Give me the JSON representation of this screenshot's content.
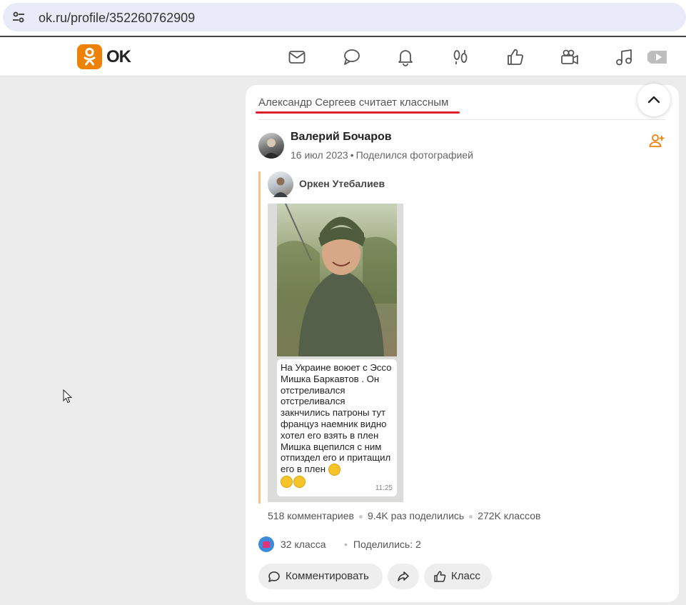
{
  "browser": {
    "url": "ok.ru/profile/352260762909"
  },
  "header": {
    "logo_text": "OK",
    "nav_icons": [
      "mail-icon",
      "chat-icon",
      "bell-icon",
      "footprints-icon",
      "like-icon",
      "video-camera-icon",
      "music-icon",
      "play-icon"
    ]
  },
  "feed": {
    "liked_by_text": "Александр Сергеев считает классным",
    "post": {
      "author": "Валерий Бочаров",
      "date": "16 июл 2023",
      "action": "Поделился фотографией",
      "reshared_from": "Оркен Утебалиев",
      "photo": {
        "caption": "На Украине воюет с Эссо Мишка Баркавтов . Он отстреливался отстреливался закнчились патроны тут француз наемник видно хотел его взять в плен Мишка вцепился с ним отпиздел его и притащил его в плен",
        "time": "11:25"
      },
      "stats": {
        "comments": "518 комментариев",
        "shares": "9.4K раз поделились",
        "likes": "272K классов"
      },
      "reactions": {
        "count_label": "32 класса",
        "shares_label": "Поделились: 2"
      },
      "actions": {
        "comment_label": "Комментировать",
        "like_label": "Класс"
      }
    }
  },
  "colors": {
    "accent": "#ee8208",
    "underline": "#e0202d",
    "repost_bar": "#f0c68a"
  }
}
